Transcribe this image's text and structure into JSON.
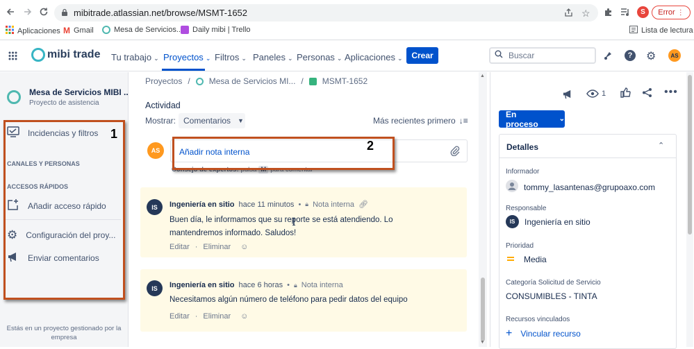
{
  "browser": {
    "url": "mibitrade.atlassian.net/browse/MSMT-1652",
    "profile_initial": "S",
    "error_label": "Error",
    "bookmarks": [
      "Aplicaciones",
      "Gmail",
      "Mesa de Servicios...",
      "Daily mibi | Trello"
    ],
    "reading_list": "Lista de lectura"
  },
  "nav": {
    "logo_text": "mibi trade",
    "items": [
      "Tu trabajo",
      "Proyectos",
      "Filtros",
      "Paneles",
      "Personas",
      "Aplicaciones"
    ],
    "create": "Crear",
    "search_placeholder": "Buscar",
    "user_initials": "AS"
  },
  "sidebar": {
    "project_name": "Mesa de Servicios MIBI ...",
    "project_type": "Proyecto de asistencia",
    "incidents": "Incidencias y filtros",
    "channels_section": "CANALES Y PERSONAS",
    "quick_section": "ACCESOS RÁPIDOS",
    "add_quick": "Añadir acceso rápido",
    "config": "Configuración del proy...",
    "feedback": "Enviar comentarios",
    "footer": "Estás en un proyecto gestionado por la empresa"
  },
  "breadcrumb": [
    "Proyectos",
    "Mesa de Servicios MI...",
    "MSMT-1652"
  ],
  "activity": {
    "title": "Actividad",
    "show_label": "Mostrar:",
    "show_value": "Comentarios",
    "sort": "Más recientes primero",
    "add_note": "Añadir nota interna",
    "tip_bold": "Consejo de expertos:",
    "tip_rest": "pulsa",
    "tip_key": "M",
    "tip_end": "para comentar",
    "author_initials": "AS"
  },
  "comments": [
    {
      "initials": "IS",
      "author": "Ingeniería en sitio",
      "time": "hace 11 minutos",
      "visibility": "Nota interna",
      "body": "Buen día, le informamos que su reporte se está atendiendo. Lo mantendremos informado. Saludos!",
      "edit": "Editar",
      "delete": "Eliminar"
    },
    {
      "initials": "IS",
      "author": "Ingeniería en sitio",
      "time": "hace 6 horas",
      "visibility": "Nota interna",
      "body": "Necesitamos algún número de teléfono para pedir datos del equipo",
      "edit": "Editar",
      "delete": "Eliminar"
    }
  ],
  "right": {
    "watchers": "1",
    "status": "En proceso",
    "details": "Detalles",
    "reporter_label": "Informador",
    "reporter": "tommy_lasantenas@grupoaxo.com",
    "assignee_label": "Responsable",
    "assignee": "Ingeniería en sitio",
    "assignee_initials": "IS",
    "priority_label": "Prioridad",
    "priority": "Media",
    "category_label": "Categoría Solicitud de Servicio",
    "category": "CONSUMIBLES - TINTA",
    "linked_label": "Recursos vinculados",
    "linked_action": "Vincular recurso"
  },
  "callouts": [
    "1",
    "2"
  ],
  "colors": {
    "primary": "#0052cc",
    "comment_bg": "#fffae6",
    "avatar_orange": "#ff991f",
    "avatar_navy": "#253858",
    "callout_box": "#c0501f"
  }
}
